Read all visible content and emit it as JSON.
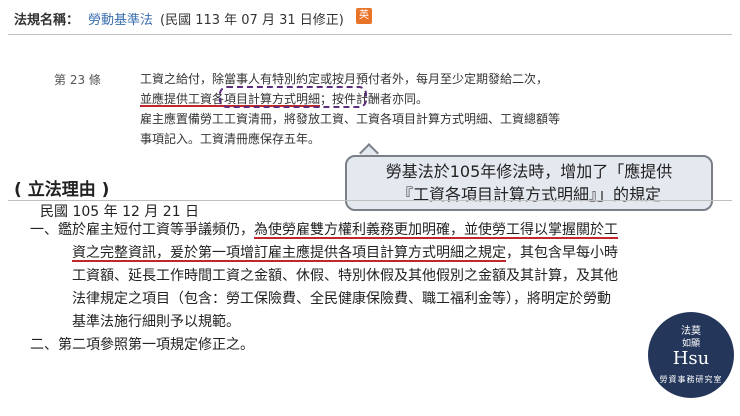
{
  "header": {
    "label": "法規名稱：",
    "law_name": "勞動基準法",
    "amend_date": "(民國 113 年 07 月 31 日修正)",
    "lang_badge": "英"
  },
  "article": {
    "number": "第 23 條",
    "p1_a": "工資之給付，除當事人有特別約定或按月預付者外，每月至少定期發給二次，",
    "p1_underlined": "並應提供工資各項目計算方式明細",
    "p1_b": "；按件計酬者亦同。",
    "p2": "雇主應置備勞工工資清冊，將發放工資、工資各項目計算方式明細、工資總額等事項記入。工資清冊應保存五年。"
  },
  "callout": {
    "line1": "勞基法於105年修法時，增加了「應提供",
    "line2": "『工資各項目計算方式明細』」的規定"
  },
  "reason": {
    "title": "( 立法理由 )",
    "date": "民國 105 年 12 月 21 日",
    "item1_prefix": "一、",
    "item1_a": "鑑於雇主短付工資等爭議頻仍，",
    "item1_red1": "為使勞雇雙方權利義務更加明確，並使勞工得以掌握關於工資之完整資訊，爰於第一項增訂雇主應提供各項目計算方式明細之規定",
    "item1_b": "，其包含早每小時工資額、延長工作時間工資之金額、休假、特別休假及其他假別之金額及其計算，及其他法律規定之項目（包含：勞工保險費、全民健康保險費、職工福利金等），將明定於勞動基準法施行細則予以規範。",
    "item2": "二、第二項參照第一項規定修正之。"
  },
  "logo": {
    "top": "法莫",
    "top2": "如顯",
    "main": "Hsu",
    "bottom": "勞資事務研究室"
  },
  "colors": {
    "link": "#3a6fb0",
    "badge": "#e8742a",
    "underline": "#c0282e",
    "dash_box": "#5b2d7a",
    "callout_bg": "#e4e8ef",
    "logo_bg": "#24365a"
  }
}
